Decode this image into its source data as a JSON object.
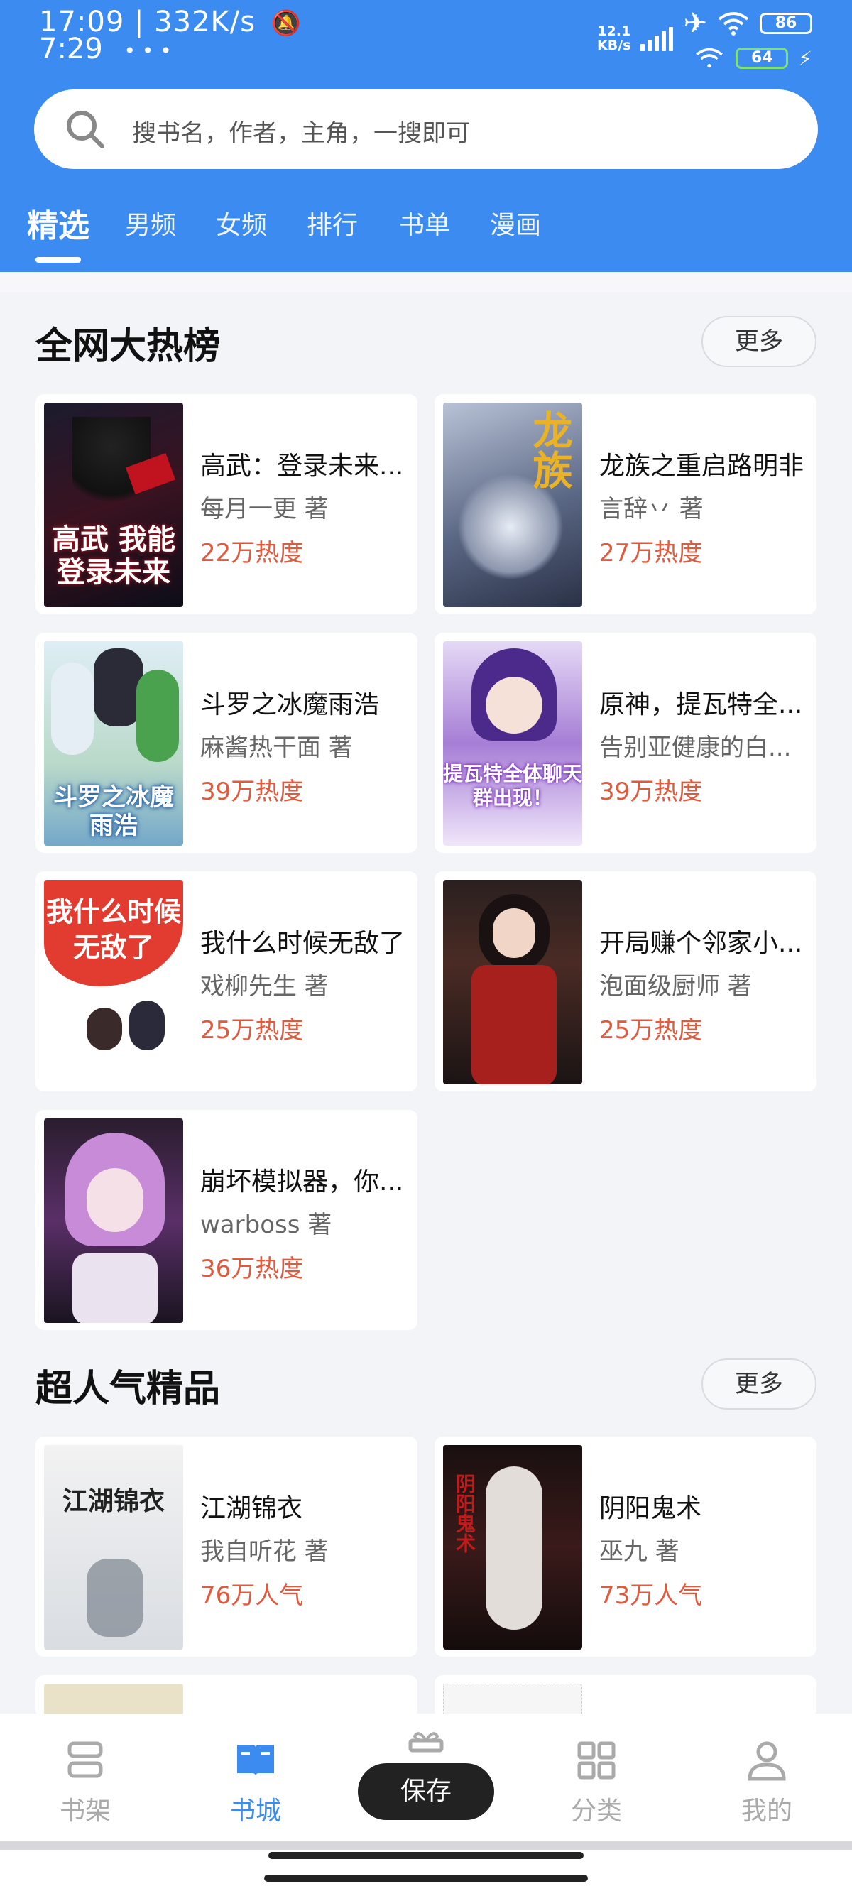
{
  "status_bar": {
    "time_line1": "17:09 | 332K/s",
    "time_line2": "7:29",
    "net_speed_value": "12.1",
    "net_speed_unit": "KB/s",
    "battery1": "86",
    "battery2": "64"
  },
  "search": {
    "placeholder": "搜书名，作者，主角，一搜即可"
  },
  "tabs": [
    {
      "label": "精选",
      "active": true
    },
    {
      "label": "男频"
    },
    {
      "label": "女频"
    },
    {
      "label": "排行"
    },
    {
      "label": "书单"
    },
    {
      "label": "漫画"
    }
  ],
  "sections": [
    {
      "title": "全网大热榜",
      "more_label": "更多",
      "books": [
        {
          "title": "高武：登录未来...",
          "author": "每月一更 著",
          "stat": "22万热度",
          "cover_text": "高武 我能登录未来"
        },
        {
          "title": "龙族之重启路明非",
          "author": "言辞丷 著",
          "stat": "27万热度",
          "cover_text": "龙族"
        },
        {
          "title": "斗罗之冰魔雨浩",
          "author": "麻酱热干面 著",
          "stat": "39万热度",
          "cover_text": "斗罗之冰魔雨浩"
        },
        {
          "title": "原神，提瓦特全...",
          "author": "告别亚健康的白...",
          "stat": "39万热度",
          "cover_text": "提瓦特全体聊天群出现！"
        },
        {
          "title": "我什么时候无敌了",
          "author": "戏柳先生 著",
          "stat": "25万热度",
          "cover_text": "我什么时候无敌了"
        },
        {
          "title": "开局赚个邻家小...",
          "author": "泡面级厨师 著",
          "stat": "25万热度",
          "cover_text": ""
        },
        {
          "title": "崩坏模拟器，你...",
          "author": "warboss 著",
          "stat": "36万热度",
          "cover_text": ""
        }
      ]
    },
    {
      "title": "超人气精品",
      "more_label": "更多",
      "books": [
        {
          "title": "江湖锦衣",
          "author": "我自听花 著",
          "stat": "76万人气",
          "cover_text": "江湖锦衣"
        },
        {
          "title": "阴阳鬼术",
          "author": "巫九 著",
          "stat": "73万人气",
          "cover_text": "阴阳鬼术"
        }
      ]
    }
  ],
  "bottom_nav": [
    {
      "label": "书架",
      "icon": "bookshelf-icon"
    },
    {
      "label": "书城",
      "icon": "book-open-icon",
      "active": true
    },
    {
      "label": "福利",
      "icon": "gift-icon"
    },
    {
      "label": "分类",
      "icon": "grid-icon"
    },
    {
      "label": "我的",
      "icon": "person-icon"
    }
  ],
  "toast": "保存",
  "colors": {
    "header_blue": "#3b8bf0",
    "stat_red": "#e25a3d",
    "background": "#f3f4f8"
  }
}
